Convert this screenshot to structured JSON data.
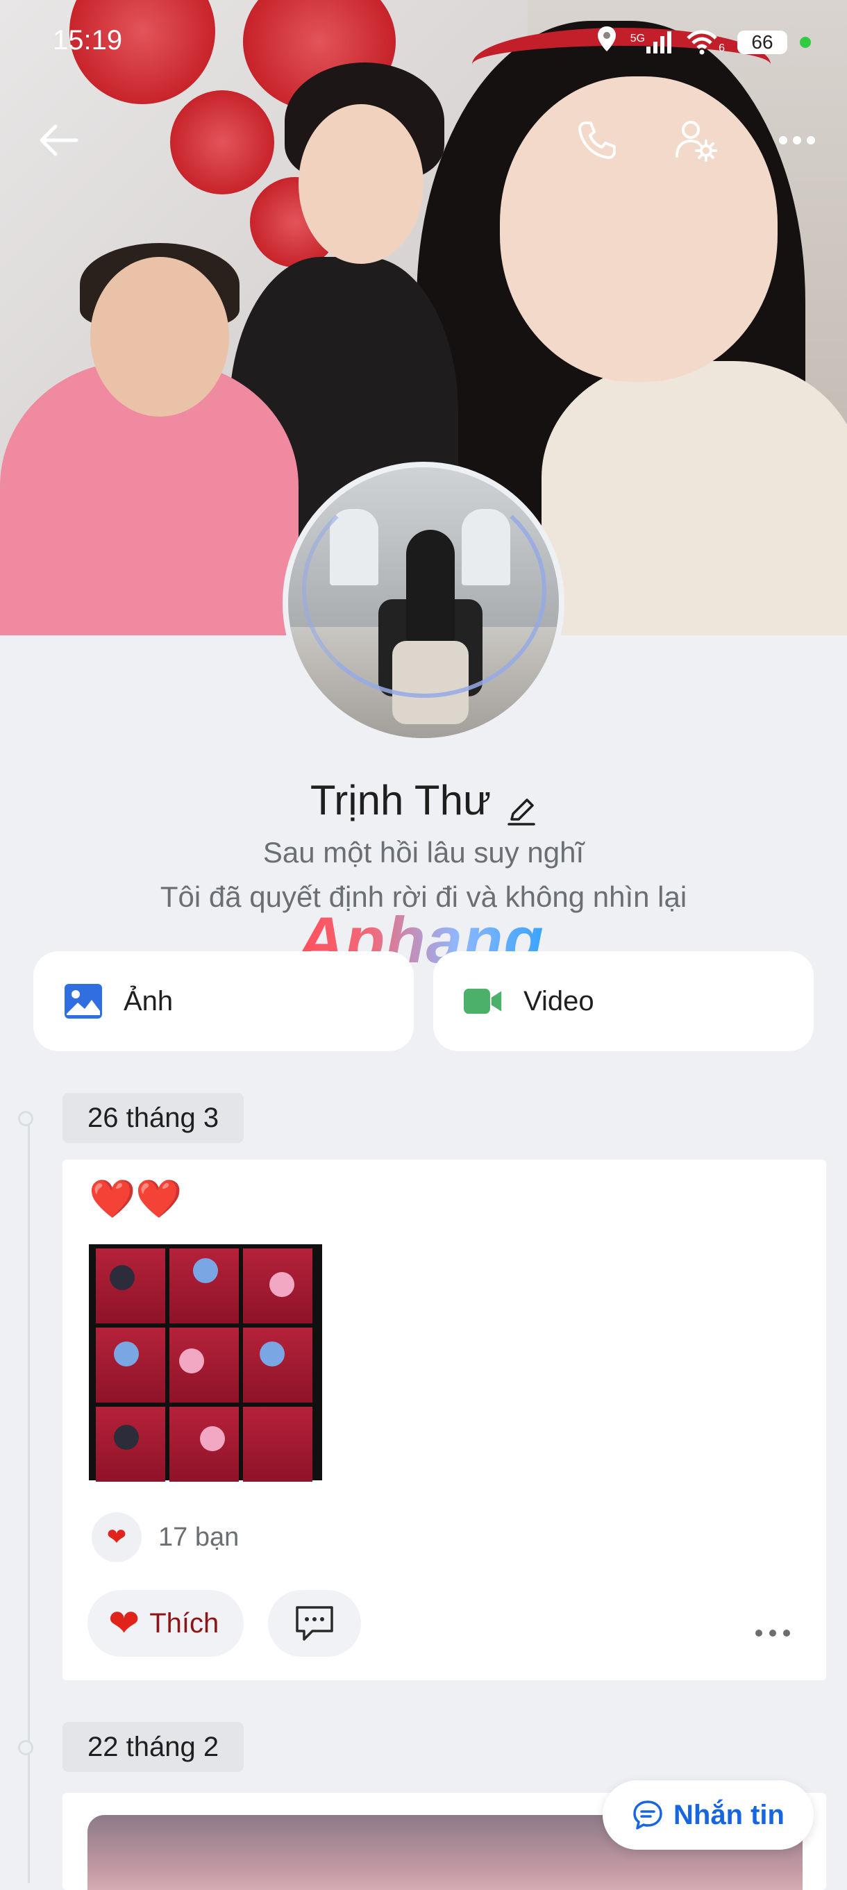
{
  "status_bar": {
    "time": "15:19",
    "network": "5G",
    "wifi_sub": "6",
    "battery": "66"
  },
  "profile": {
    "name": "Trịnh Thư",
    "bio_line1": "Sau một hồi lâu suy nghĩ",
    "bio_line2": "Tôi đã quyết định rời đi và không nhìn lại",
    "watermark": "Aphang"
  },
  "media": {
    "photos_label": "Ảnh",
    "videos_label": "Video"
  },
  "timeline": [
    {
      "date": "26 tháng 3",
      "caption": "❤️❤️",
      "reaction_count": "17 bạn",
      "like_label": "Thích"
    },
    {
      "date": "22 tháng 2"
    }
  ],
  "message_button": {
    "label": "Nhắn tin"
  },
  "colors": {
    "accent": "#1766e0",
    "like": "#e0241b",
    "video_green": "#4caf6a",
    "photo_blue": "#2f6fe0"
  }
}
